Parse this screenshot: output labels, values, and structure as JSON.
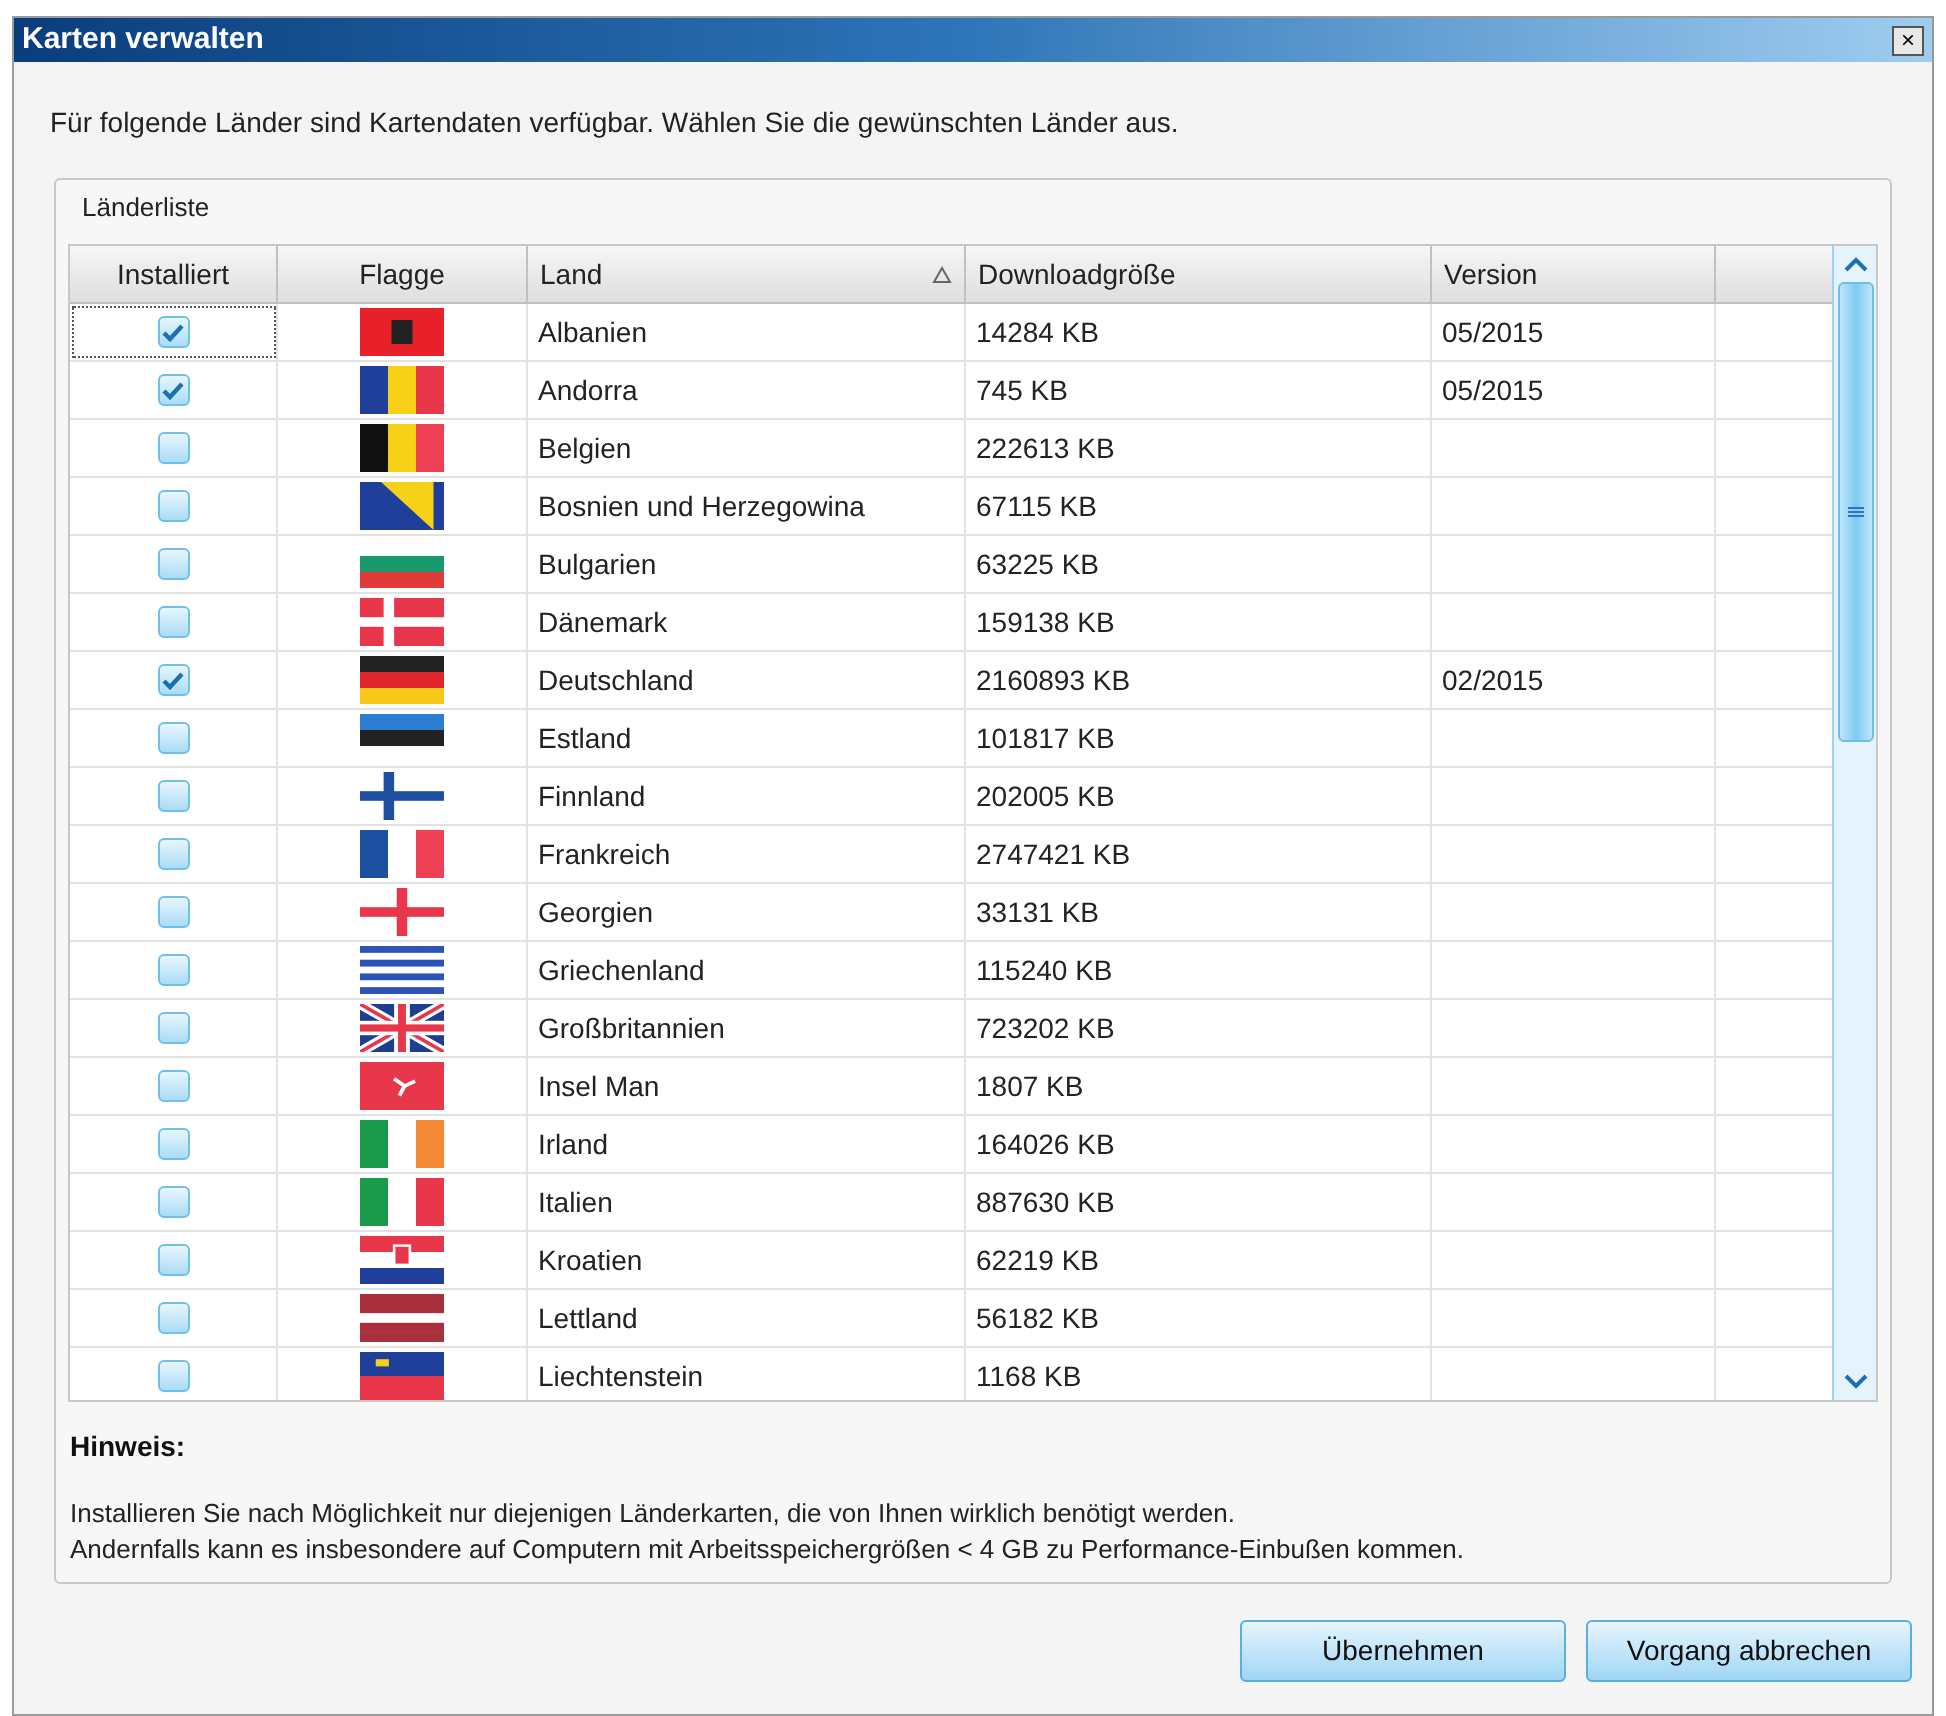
{
  "window": {
    "title": "Karten verwalten",
    "close": "×"
  },
  "intro": "Für folgende Länder sind Kartendaten verfügbar. Wählen Sie die gewünschten Länder aus.",
  "group": {
    "title": "Länderliste"
  },
  "table": {
    "columns": [
      {
        "label": "Installiert",
        "sorted": false
      },
      {
        "label": "Flagge",
        "sorted": false
      },
      {
        "label": "Land",
        "sorted": true
      },
      {
        "label": "Downloadgröße",
        "sorted": false
      },
      {
        "label": "Version",
        "sorted": false
      }
    ],
    "rows": [
      {
        "installed": true,
        "focused": true,
        "land": "Albanien",
        "size": "14284 KB",
        "version": "05/2015"
      },
      {
        "installed": true,
        "focused": false,
        "land": "Andorra",
        "size": "745 KB",
        "version": "05/2015"
      },
      {
        "installed": false,
        "focused": false,
        "land": "Belgien",
        "size": "222613 KB"
      },
      {
        "installed": false,
        "focused": false,
        "land": "Bosnien und Herzegowina",
        "size": "67115 KB"
      },
      {
        "installed": false,
        "focused": false,
        "land": "Bulgarien",
        "size": "63225 KB"
      },
      {
        "installed": false,
        "focused": false,
        "land": "Dänemark",
        "size": "159138 KB"
      },
      {
        "installed": true,
        "focused": false,
        "land": "Deutschland",
        "size": "2160893 KB",
        "version": "02/2015"
      },
      {
        "installed": false,
        "focused": false,
        "land": "Estland",
        "size": "101817 KB"
      },
      {
        "installed": false,
        "focused": false,
        "land": "Finnland",
        "size": "202005 KB"
      },
      {
        "installed": false,
        "focused": false,
        "land": "Frankreich",
        "size": "2747421 KB"
      },
      {
        "installed": false,
        "focused": false,
        "land": "Georgien",
        "size": "33131 KB"
      },
      {
        "installed": false,
        "focused": false,
        "land": "Griechenland",
        "size": "115240 KB"
      },
      {
        "installed": false,
        "focused": false,
        "land": "Großbritannien",
        "size": "723202 KB"
      },
      {
        "installed": false,
        "focused": false,
        "land": "Insel Man",
        "size": "1807 KB"
      },
      {
        "installed": false,
        "focused": false,
        "land": "Irland",
        "size": "164026 KB"
      },
      {
        "installed": false,
        "focused": false,
        "land": "Italien",
        "size": "887630 KB"
      },
      {
        "installed": false,
        "focused": false,
        "land": "Kroatien",
        "size": "62219 KB"
      },
      {
        "installed": false,
        "focused": false,
        "land": "Lettland",
        "size": "56182 KB"
      },
      {
        "installed": false,
        "focused": false,
        "land": "Liechtenstein",
        "size": "1168 KB"
      }
    ]
  },
  "note": {
    "title": "Hinweis:",
    "lines": [
      "Installieren Sie nach Möglichkeit nur diejenigen Länderkarten, die von Ihnen wirklich benötigt werden.",
      "Andernfalls kann es insbesondere auf Computern mit Arbeitsspeichergrößen < 4 GB zu Performance-Einbußen kommen."
    ]
  },
  "buttons": [
    "Übernehmen",
    "Vorgang abbrechen"
  ]
}
